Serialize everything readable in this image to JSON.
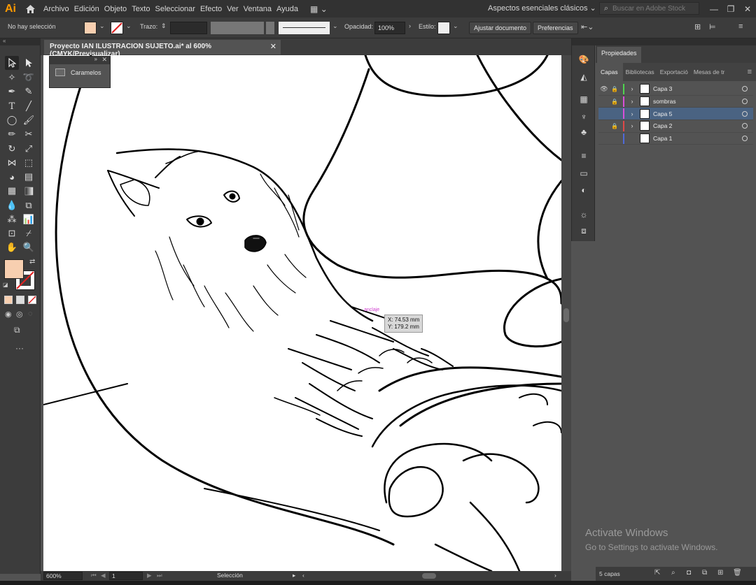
{
  "app": {
    "logo": "Ai",
    "home_icon": "home-icon"
  },
  "menu": [
    "Archivo",
    "Edición",
    "Objeto",
    "Texto",
    "Seleccionar",
    "Efecto",
    "Ver",
    "Ventana",
    "Ayuda"
  ],
  "workspace": "Aspectos esenciales clásicos",
  "stock_search_placeholder": "Buscar en Adobe Stock",
  "control": {
    "selection": "No hay selección",
    "fill_color": "#f7cfb0",
    "stroke_label": "Trazo:",
    "opacity_label": "Opacidad:",
    "opacity_value": "100%",
    "style_label": "Estilo:",
    "fit_button": "Ajustar documento",
    "prefs_button": "Preferencias"
  },
  "document": {
    "tab_title": "Proyecto IAN ILUSTRACION SUJETO.ai* al 600% (CMYK/Previsualizar)",
    "zoom": "600%",
    "artboard": "1",
    "tool_status": "Selección"
  },
  "tooltip": {
    "x": "X: 74.53 mm",
    "y": "Y: 179.2 mm",
    "smart_label": "anclaje"
  },
  "swatch_panel": {
    "item": "Caramelos"
  },
  "properties_tab": "Propiedades",
  "layer_tabs": [
    "Capas",
    "Bibliotecas",
    "Exportació",
    "Mesas de tr"
  ],
  "layers": [
    {
      "name": "Capa 3",
      "color": "#4fd44f",
      "visible": true,
      "locked": true,
      "selected": false
    },
    {
      "name": "sombras",
      "color": "#d94fd9",
      "visible": false,
      "locked": true,
      "selected": false
    },
    {
      "name": "Capa 5",
      "color": "#d94fd9",
      "visible": false,
      "locked": false,
      "selected": true
    },
    {
      "name": "Capa 2",
      "color": "#e04848",
      "visible": false,
      "locked": true,
      "selected": false
    },
    {
      "name": "Capa 1",
      "color": "#4f6ad9",
      "visible": false,
      "locked": false,
      "selected": false
    }
  ],
  "layer_count": "5 capas",
  "watermark": {
    "line1": "Activate Windows",
    "line2": "Go to Settings to activate Windows."
  }
}
